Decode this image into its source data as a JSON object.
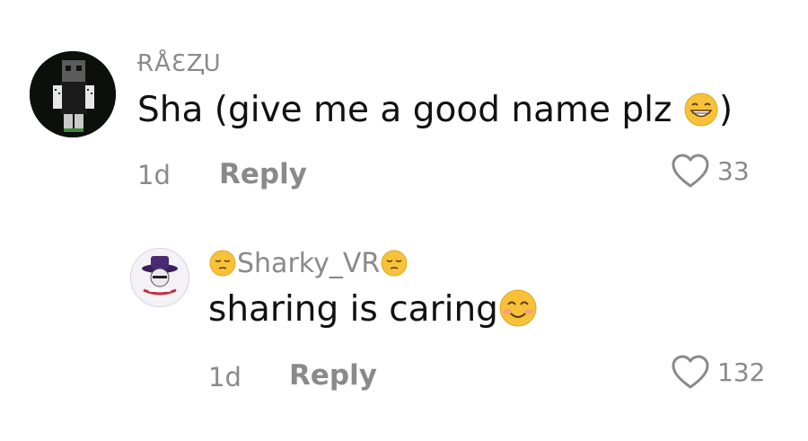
{
  "comments": [
    {
      "username": "ɌÅƐⱫU",
      "text": "Sha (give me a good name plz ",
      "text_suffix": ")",
      "time": "1d",
      "reply_label": "Reply",
      "like_count": "33",
      "avatar_icon": "minecraft-skin-avatar",
      "emoji_icon": "grinning-squinting-face"
    },
    {
      "username": "Sharky_VR",
      "text": "sharing is caring",
      "time": "1d",
      "reply_label": "Reply",
      "like_count": "132",
      "avatar_icon": "purple-hat-avatar",
      "name_emoji_icon": "pensive-face",
      "emoji_icon": "smiling-face-with-smiling-eyes"
    }
  ],
  "colors": {
    "muted_text": "#8a8a8a",
    "body_text": "#111111",
    "emoji_yellow": "#f7c23a"
  }
}
